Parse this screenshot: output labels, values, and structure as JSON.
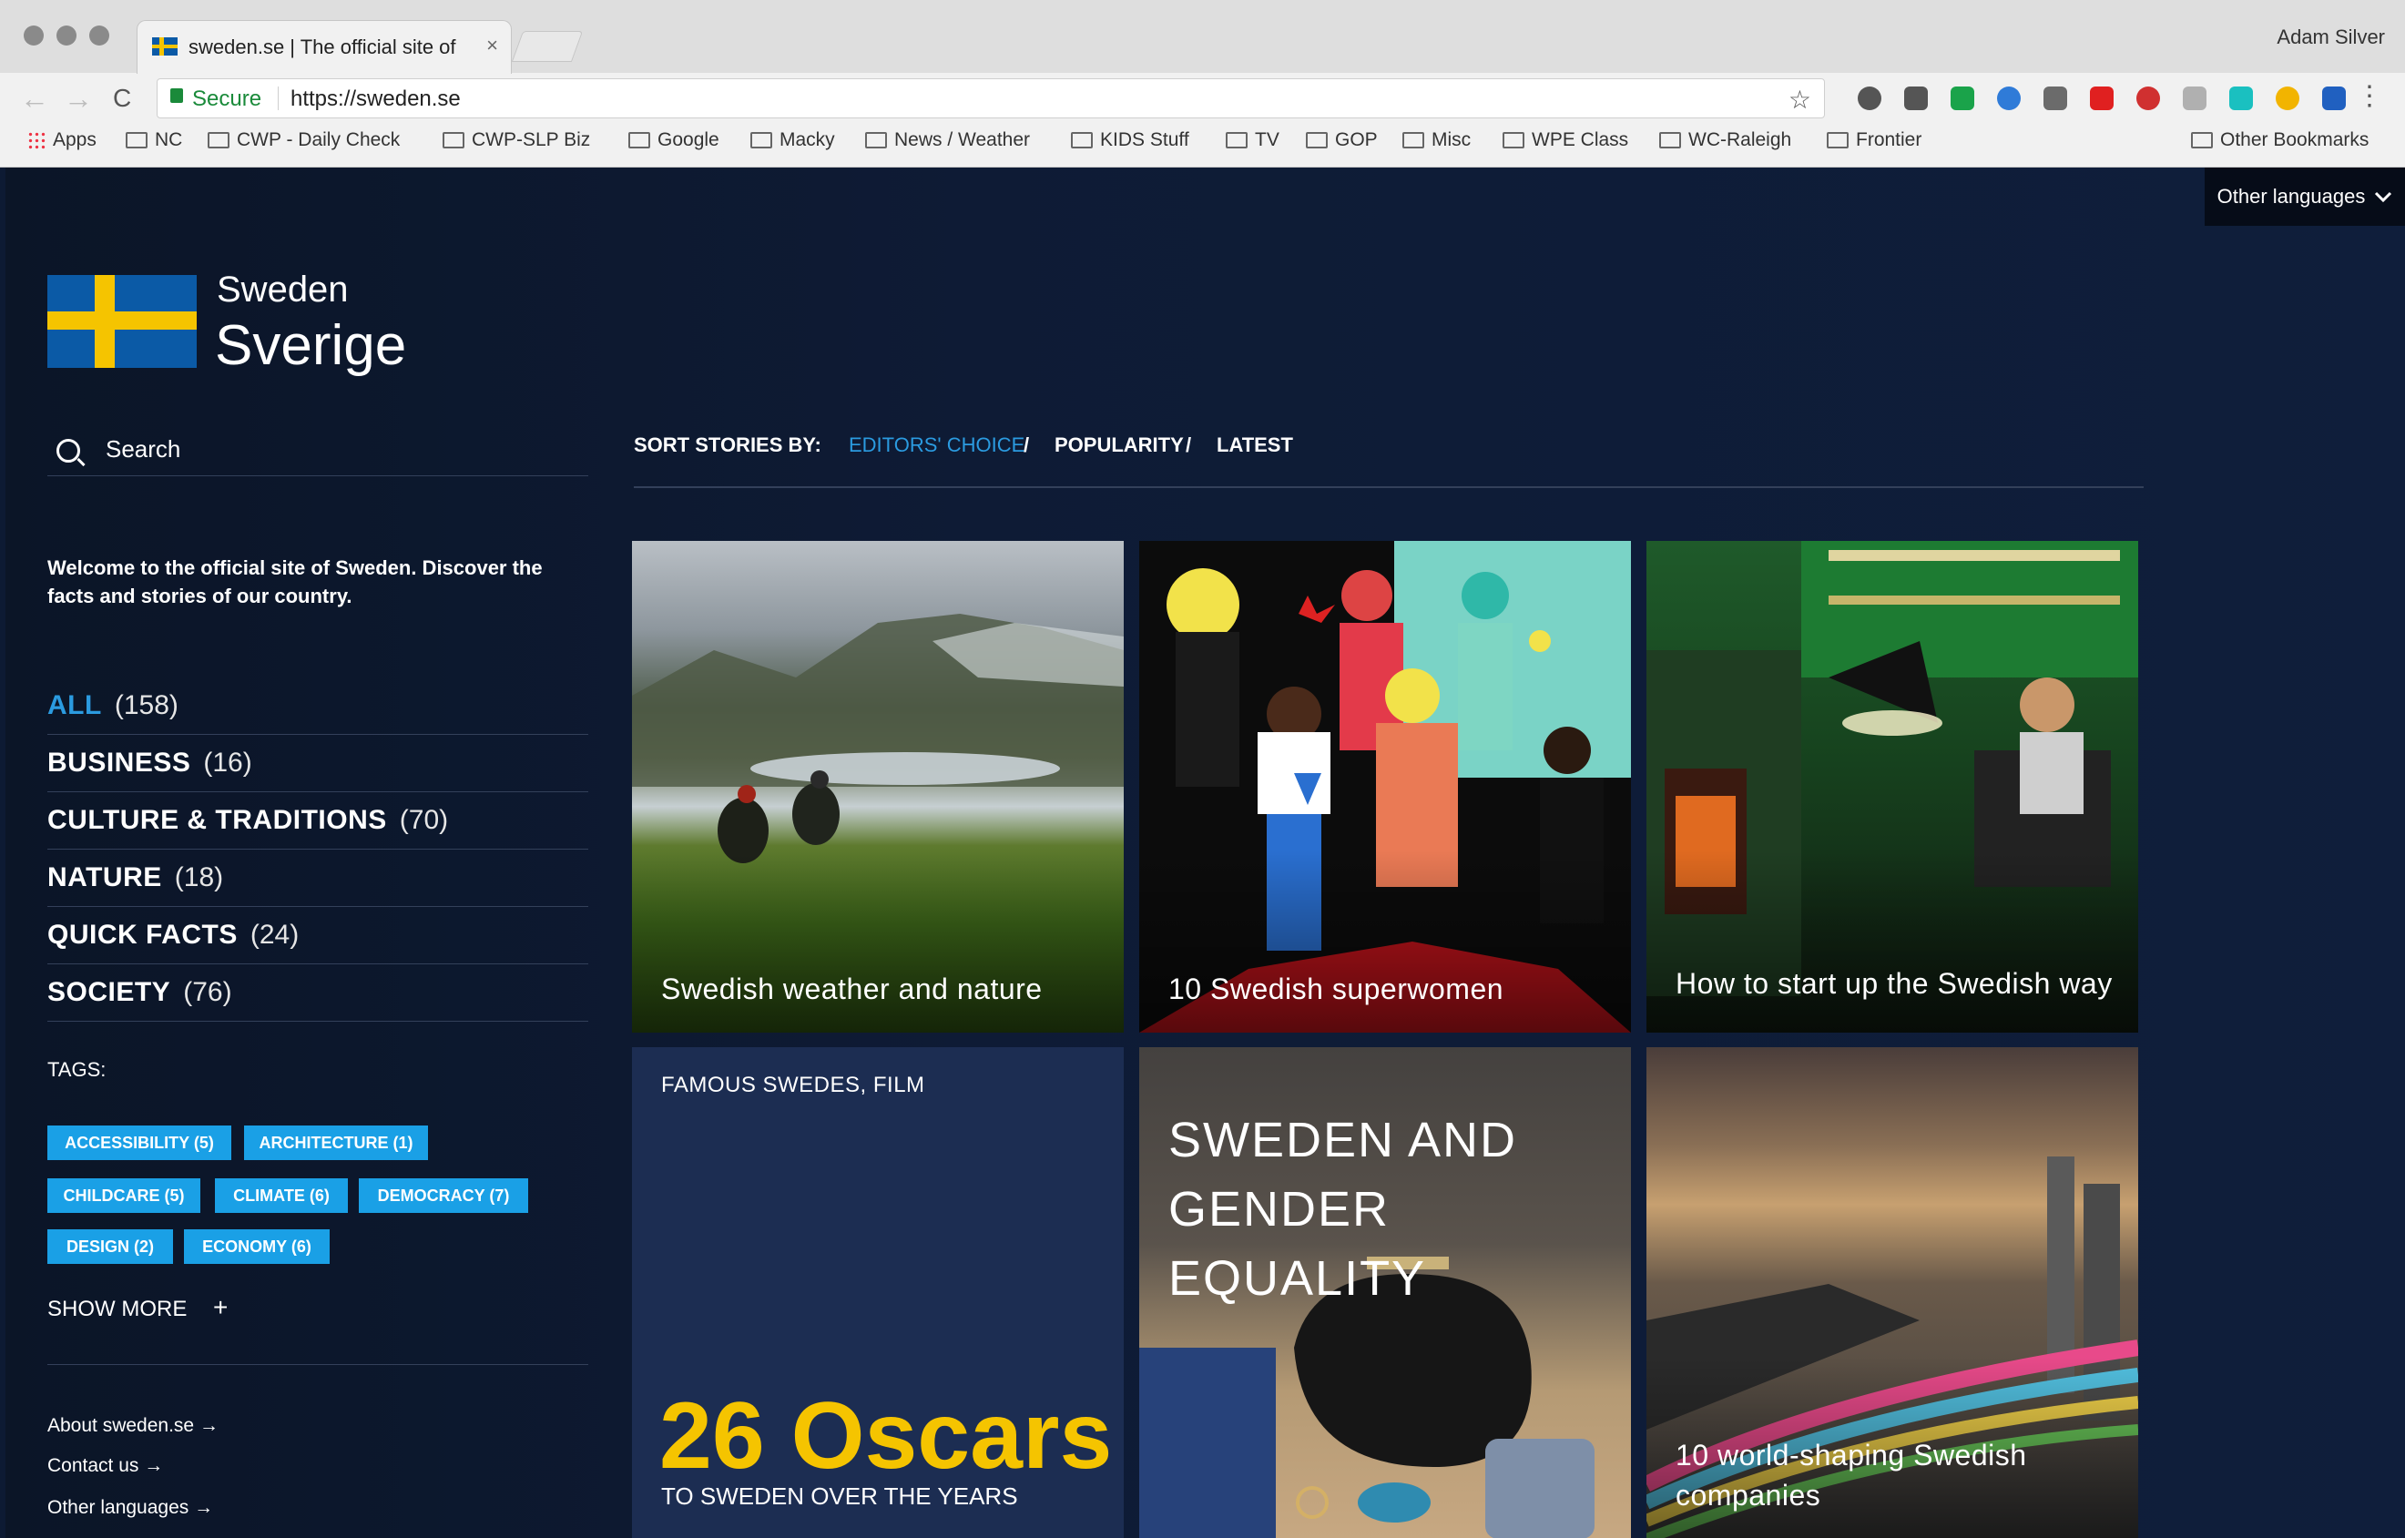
{
  "browser": {
    "tab_title": "sweden.se | The official site of",
    "tab_close": "×",
    "profile_name": "Adam Silver",
    "secure_label": "Secure",
    "url": "https://sweden.se",
    "back": "←",
    "forward": "→",
    "reload": "C",
    "star": "☆",
    "menu": "⋮",
    "bookmarks": [
      "Apps",
      "NC",
      "CWP - Daily Check",
      "CWP-SLP Biz",
      "Google",
      "Macky",
      "News / Weather",
      "KIDS Stuff",
      "TV",
      "GOP",
      "Misc",
      "WPE Class",
      "WC-Raleigh",
      "Frontier"
    ],
    "other_bookmarks": "Other Bookmarks",
    "extension_colors": [
      "#555555",
      "#555555",
      "#1aa34a",
      "#2f7bd8",
      "#6b6b6b",
      "#e02020",
      "#d03030",
      "#b0b0b0",
      "#1ac0c0",
      "#f2b400",
      "#2060c0"
    ]
  },
  "site": {
    "other_languages_button": "Other languages",
    "logo_top": "Sweden",
    "logo_bottom": "Sverige",
    "search_label": "Search",
    "welcome": "Welcome to the official site of Sweden. Discover the facts and stories of our country.",
    "categories": [
      {
        "name": "ALL",
        "count": "(158)"
      },
      {
        "name": "BUSINESS",
        "count": "(16)"
      },
      {
        "name": "CULTURE & TRADITIONS",
        "count": "(70)"
      },
      {
        "name": "NATURE",
        "count": "(18)"
      },
      {
        "name": "QUICK FACTS",
        "count": "(24)"
      },
      {
        "name": "SOCIETY",
        "count": "(76)"
      }
    ],
    "tags_label": "TAGS:",
    "tags": [
      "ACCESSIBILITY (5)",
      "ARCHITECTURE (1)",
      "CHILDCARE (5)",
      "CLIMATE (6)",
      "DEMOCRACY (7)",
      "DESIGN (2)",
      "ECONOMY (6)"
    ],
    "show_more": "SHOW MORE",
    "show_more_icon": "+",
    "footer_links": [
      "About sweden.se",
      "Contact us",
      "Other languages"
    ],
    "sort": {
      "label": "SORT STORIES BY:",
      "options": [
        "EDITORS' CHOICE",
        "POPULARITY",
        "LATEST"
      ],
      "separator": "/"
    },
    "cards": [
      {
        "caption": "Swedish weather and nature"
      },
      {
        "caption": "10 Swedish superwomen"
      },
      {
        "caption": "How to start up the Swedish way"
      },
      {
        "kicker": "FAMOUS SWEDES, FILM",
        "big": "26 Oscars",
        "sub": "TO SWEDEN OVER THE YEARS"
      },
      {
        "caption": "SWEDEN AND GENDER EQUALITY"
      },
      {
        "caption": "10 world-shaping Swedish companies"
      }
    ],
    "colors": {
      "accent_blue": "#2b9be0",
      "tag_blue": "#1aa0e6",
      "oscars_yellow": "#f5c400",
      "bg": "#0f1e3b"
    }
  }
}
